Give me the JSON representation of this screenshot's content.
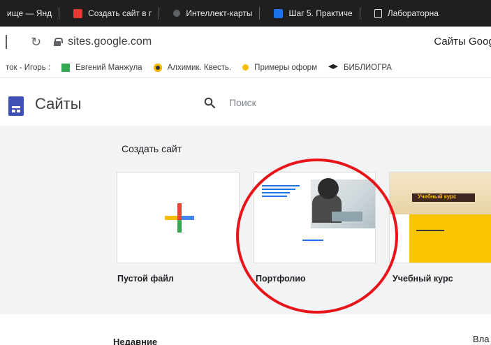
{
  "browser": {
    "tabs": [
      {
        "title": "ище — Янд",
        "icon": "none"
      },
      {
        "title": "Создать сайт в г",
        "icon": "red-square-icon"
      },
      {
        "title": "Интеллект-карты",
        "icon": "dot-icon"
      },
      {
        "title": "Шаг 5. Практиче",
        "icon": "blue-square-icon"
      },
      {
        "title": "Лабораторна",
        "icon": "document-icon"
      }
    ],
    "url": "sites.google.com",
    "page_title": "Сайты Googl",
    "bookmarks": [
      {
        "title": "ток - Игорь :",
        "icon": "none"
      },
      {
        "title": "Евгений Манжула",
        "icon": "green-square-icon"
      },
      {
        "title": "Алхимик. Квесть.",
        "icon": "radiation-icon"
      },
      {
        "title": "Примеры оформ",
        "icon": "lightbulb-icon"
      },
      {
        "title": "БИБЛИОГРА",
        "icon": "graduation-cap-icon"
      }
    ]
  },
  "app": {
    "name": "Сайты",
    "search_placeholder": "Поиск"
  },
  "create": {
    "title": "Создать сайт",
    "templates": [
      {
        "label": "Пустой файл"
      },
      {
        "label": "Портфолио"
      },
      {
        "label": "Учебный курс"
      }
    ],
    "course_thumb_heading": "Учебный курс"
  },
  "recent": {
    "title": "Недавние",
    "owner_column": "Вла"
  },
  "colors": {
    "highlight": "#e8141a",
    "sites_brand": "#3f51b5",
    "course_yellow": "#f9c400"
  }
}
